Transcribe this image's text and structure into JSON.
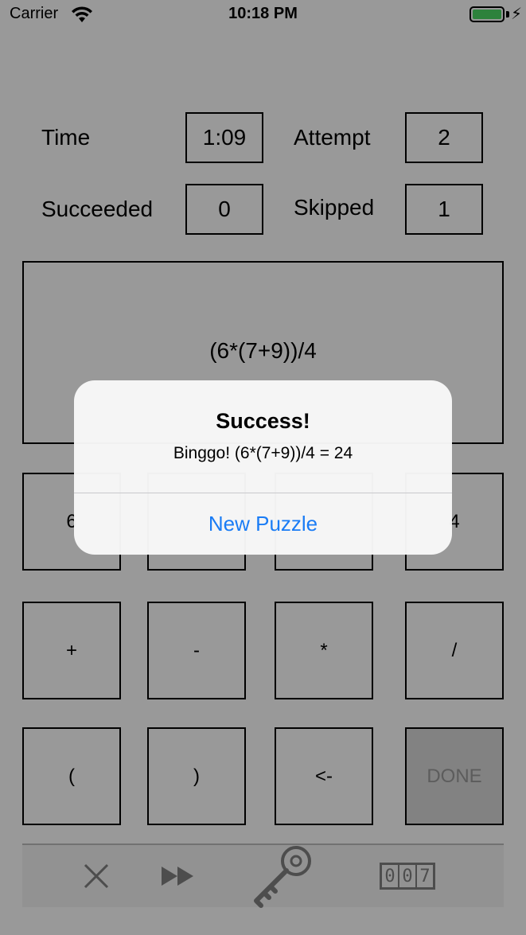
{
  "status_bar": {
    "carrier": "Carrier",
    "time": "10:18 PM",
    "wifi_icon": "wifi-icon",
    "battery_icon": "battery-charging-icon",
    "battery_color": "#4cd964"
  },
  "stats": {
    "time_label": "Time",
    "time_value": "1:09",
    "attempt_label": "Attempt",
    "attempt_value": "2",
    "succeeded_label": "Succeeded",
    "succeeded_value": "0",
    "skipped_label": "Skipped",
    "skipped_value": "1"
  },
  "expression": "(6*(7+9))/4",
  "number_keys": [
    "6",
    "",
    "",
    "4"
  ],
  "operator_keys": [
    "+",
    "-",
    "*",
    "/"
  ],
  "control_keys": [
    "(",
    ")",
    "<-",
    "DONE"
  ],
  "toolbar": {
    "icons": [
      "close-icon",
      "fast-forward-icon",
      "key-icon",
      "counter-icon"
    ],
    "counter_digits": [
      "0",
      "0",
      "7"
    ]
  },
  "alert": {
    "title": "Success!",
    "message": "Binggo! (6*(7+9))/4 = 24",
    "button": "New Puzzle",
    "button_color": "#1a7cf5"
  }
}
